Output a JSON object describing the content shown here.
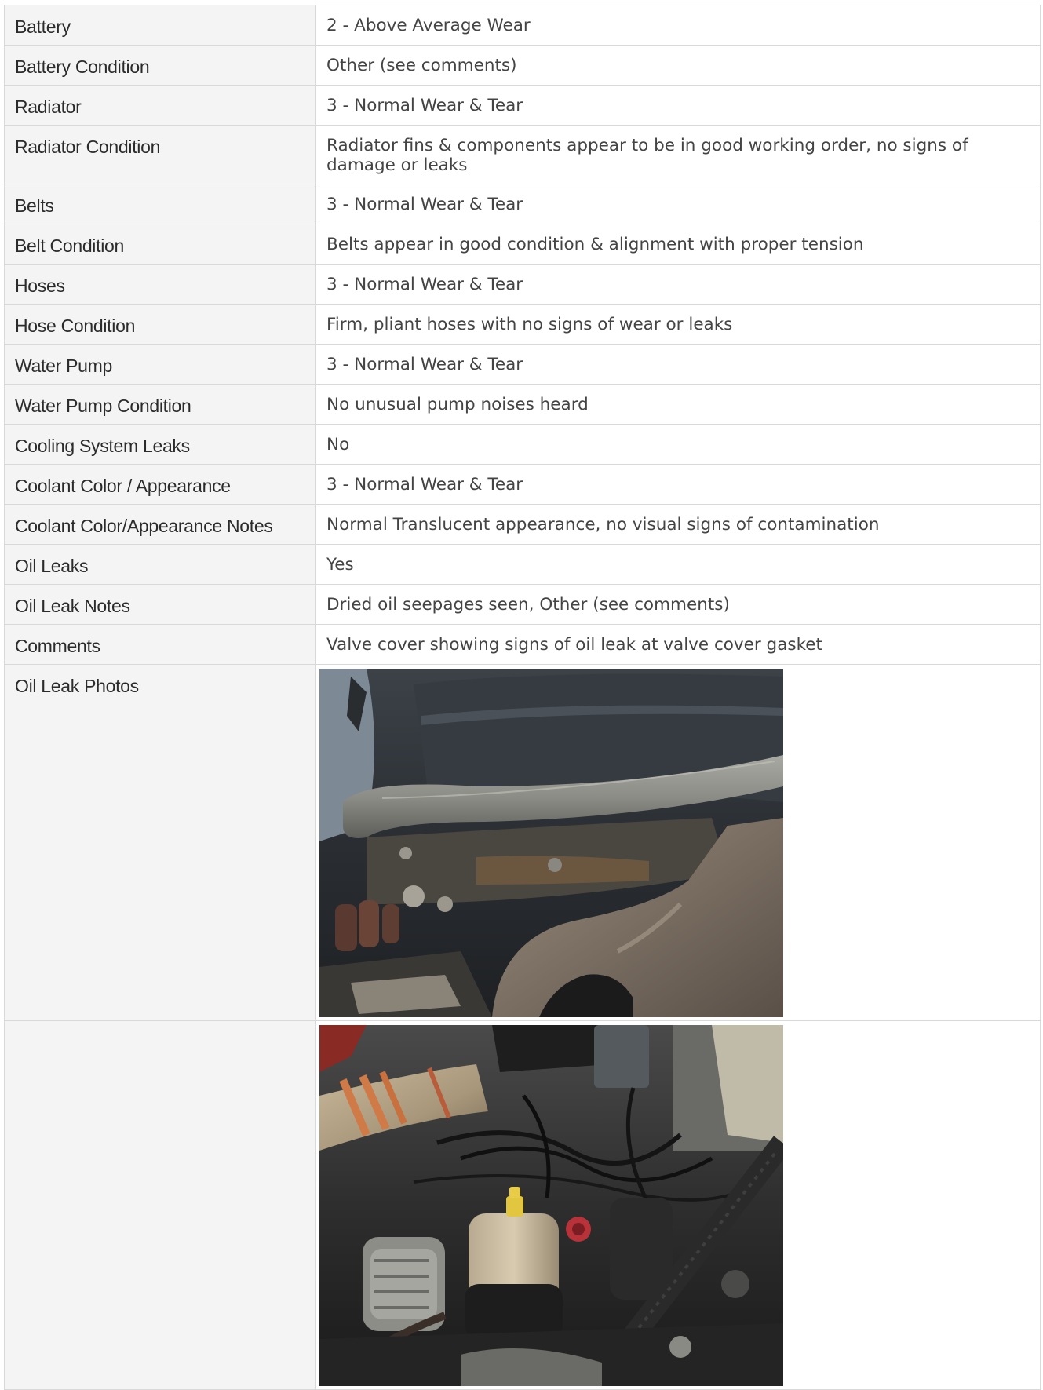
{
  "rows": [
    {
      "label": "Battery",
      "value": "2 - Above Average Wear"
    },
    {
      "label": "Battery Condition",
      "value": "Other (see comments)"
    },
    {
      "label": "Radiator",
      "value": "3 - Normal Wear & Tear"
    },
    {
      "label": "Radiator Condition",
      "value": "Radiator fins & components appear to be in good working order, no signs of damage or leaks"
    },
    {
      "label": "Belts",
      "value": "3 - Normal Wear & Tear"
    },
    {
      "label": "Belt Condition",
      "value": "Belts appear in good condition & alignment with proper tension"
    },
    {
      "label": "Hoses",
      "value": "3 - Normal Wear & Tear"
    },
    {
      "label": "Hose Condition",
      "value": "Firm, pliant hoses with no signs of wear or leaks"
    },
    {
      "label": "Water Pump",
      "value": "3 - Normal Wear & Tear"
    },
    {
      "label": "Water Pump Condition",
      "value": "No unusual pump noises heard"
    },
    {
      "label": "Cooling System Leaks",
      "value": "No"
    },
    {
      "label": "Coolant Color / Appearance",
      "value": "3 - Normal Wear & Tear"
    },
    {
      "label": "Coolant Color/Appearance Notes",
      "value": "Normal Translucent appearance, no visual signs of contamination"
    },
    {
      "label": "Oil Leaks",
      "value": "Yes"
    },
    {
      "label": "Oil Leak Notes",
      "value": "Dried oil seepages seen, Other (see comments)"
    },
    {
      "label": "Comments",
      "value": "Valve cover showing signs of oil leak at valve cover gasket"
    }
  ],
  "photos": {
    "label": "Oil Leak Photos"
  },
  "colors": {
    "label_bg": "#f4f4f4",
    "border": "#d9d9d9",
    "label_text": "#2b2b2b",
    "value_text": "#444444"
  }
}
